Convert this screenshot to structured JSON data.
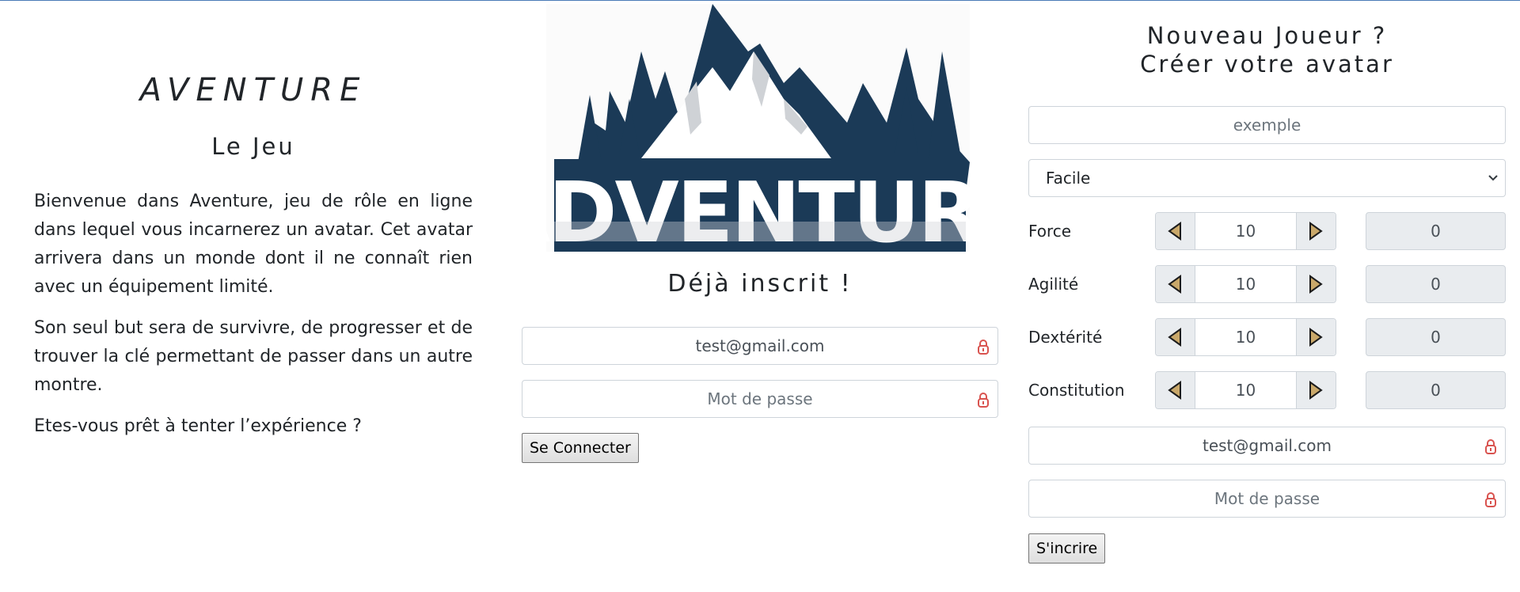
{
  "intro": {
    "title": "AVENTURE",
    "subtitle": "Le Jeu",
    "paragraphs": [
      "Bienvenue dans Aventure, jeu de rôle en ligne dans lequel vous incarnerez un avatar. Cet avatar arrivera dans un monde dont il ne connaît rien avec un équipement limité.",
      "Son seul but sera de survivre, de progresser et de trouver la clé permettant de passer dans un autre montre.",
      "Etes-vous prêt à tenter l’expérience ?"
    ]
  },
  "logo": {
    "text": "ADVENTURE",
    "icon": "mountain-logo"
  },
  "login": {
    "title": "Déjà inscrit !",
    "email_value": "test@gmail.com",
    "password_placeholder": "Mot de passe",
    "submit_label": "Se Connecter"
  },
  "register": {
    "title_line1": "Nouveau Joueur ?",
    "title_line2": "Créer votre avatar",
    "name_placeholder": "exemple",
    "difficulty_selected": "Facile",
    "stats": [
      {
        "label": "Force",
        "value": "10",
        "bonus": "0"
      },
      {
        "label": "Agilité",
        "value": "10",
        "bonus": "0"
      },
      {
        "label": "Dextérité",
        "value": "10",
        "bonus": "0"
      },
      {
        "label": "Constitution",
        "value": "10",
        "bonus": "0"
      }
    ],
    "email_value": "test@gmail.com",
    "password_placeholder": "Mot de passe",
    "submit_label": "S'incrire"
  },
  "colors": {
    "logo_navy": "#1b3a57",
    "arrow_gold": "#c9a86a",
    "lock_red": "#d9534f",
    "top_border": "#4a7bb7"
  }
}
